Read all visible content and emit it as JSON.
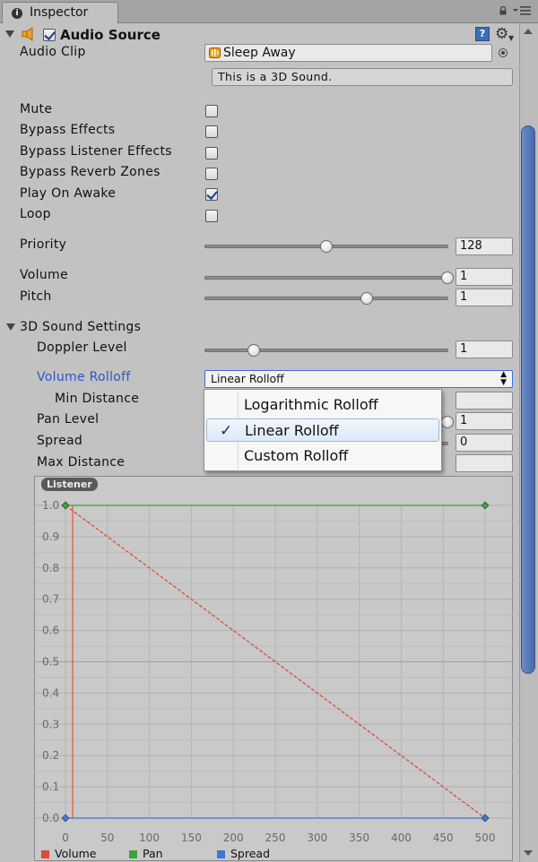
{
  "tab": {
    "label": "Inspector"
  },
  "component": {
    "title": "Audio Source",
    "enabled": true
  },
  "audio_clip": {
    "label": "Audio Clip",
    "value": "Sleep Away",
    "info": "This is a 3D Sound."
  },
  "toggles": [
    {
      "label": "Mute",
      "checked": false
    },
    {
      "label": "Bypass Effects",
      "checked": false
    },
    {
      "label": "Bypass Listener Effects",
      "checked": false
    },
    {
      "label": "Bypass Reverb Zones",
      "checked": false
    },
    {
      "label": "Play On Awake",
      "checked": true
    },
    {
      "label": "Loop",
      "checked": false
    }
  ],
  "sliders": {
    "priority": {
      "label": "Priority",
      "value": "128",
      "fraction": 0.5
    },
    "volume": {
      "label": "Volume",
      "value": "1",
      "fraction": 1.0
    },
    "pitch": {
      "label": "Pitch",
      "value": "1",
      "fraction": 0.667
    },
    "doppler": {
      "label": "Doppler Level",
      "value": "1",
      "fraction": 0.2
    }
  },
  "sound3d": {
    "section_label": "3D Sound Settings",
    "rolloff_label": "Volume Rolloff",
    "rolloff_value": "Linear Rolloff",
    "min_distance_label": "Min Distance",
    "pan_level_label": "Pan Level",
    "pan_level_value": "1",
    "spread_label": "Spread",
    "spread_value": "0",
    "max_distance_label": "Max Distance"
  },
  "rolloff_options": [
    {
      "label": "Logarithmic Rolloff",
      "selected": false
    },
    {
      "label": "Linear Rolloff",
      "selected": true
    },
    {
      "label": "Custom Rolloff",
      "selected": false
    }
  ],
  "graph": {
    "badge": "Listener"
  },
  "colors": {
    "volume": "#e04a3a",
    "pan": "#3aa43a",
    "spread": "#3c78d8",
    "accent": "#2f56c9"
  },
  "chart_data": {
    "type": "line",
    "x_ticks": [
      "0",
      "50",
      "100",
      "150",
      "200",
      "250",
      "300",
      "350",
      "400",
      "450",
      "500"
    ],
    "y_ticks": [
      "0.0",
      "0.1",
      "0.2",
      "0.3",
      "0.4",
      "0.5",
      "0.6",
      "0.7",
      "0.8",
      "0.9",
      "1.0"
    ],
    "xlim": [
      0,
      500
    ],
    "ylim": [
      0,
      1
    ],
    "grid": true,
    "legend_position": "bottom",
    "series": [
      {
        "name": "Volume",
        "x": [
          0,
          500
        ],
        "y": [
          1.0,
          0.0
        ]
      },
      {
        "name": "Pan",
        "x": [
          0,
          500
        ],
        "y": [
          1.0,
          1.0
        ]
      },
      {
        "name": "Spread",
        "x": [
          0,
          500
        ],
        "y": [
          0.0,
          0.0
        ]
      }
    ]
  }
}
